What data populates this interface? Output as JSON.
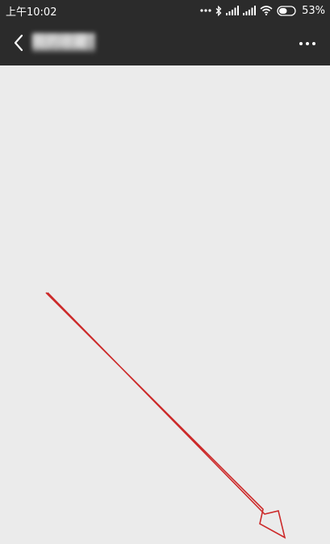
{
  "status_bar": {
    "time": "上午10:02",
    "battery_percent": "53%",
    "battery_level": 0.53,
    "icons": [
      "more-dots-icon",
      "bluetooth-icon",
      "signal-icon",
      "signal-icon",
      "wifi-icon",
      "battery-icon"
    ]
  },
  "header": {
    "title": "我的收藏",
    "back_icon": "chevron-left-icon",
    "more_icon": "more-horizontal-icon",
    "background": "#2b2b2b"
  },
  "content": {
    "background": "#ebebeb",
    "annotation_icon": "arrow-down-right-icon",
    "annotation_color": "#cc2a2a"
  }
}
